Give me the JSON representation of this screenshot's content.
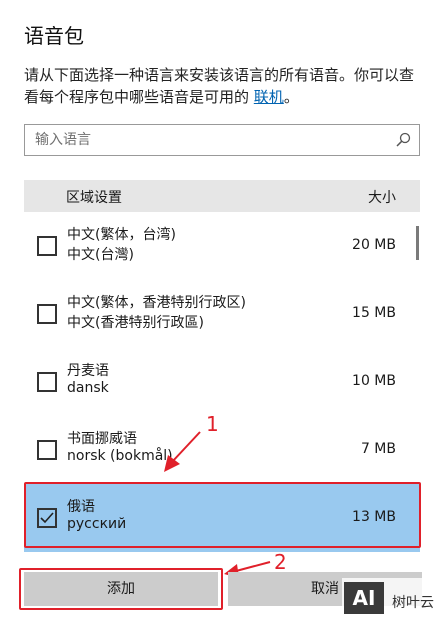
{
  "page": {
    "title": "语音包",
    "description_text": "请从下面选择一种语言来安装该语言的所有语音。你可以查看每个程序包中哪些语音是可用的",
    "description_link": "联机",
    "description_end": "。"
  },
  "search": {
    "placeholder": "输入语言",
    "icon": "search-icon"
  },
  "list": {
    "header": {
      "region": "区域设置",
      "size": "大小"
    },
    "rows": [
      {
        "name": "中文(繁体，台湾)",
        "native": "中文(台灣)",
        "size": "20 MB",
        "checked": false
      },
      {
        "name": "中文(繁体，香港特别行政区)",
        "native": "中文(香港特别行政區)",
        "size": "15 MB",
        "checked": false
      },
      {
        "name": "丹麦语",
        "native": "dansk",
        "size": "10 MB",
        "checked": false
      },
      {
        "name": "书面挪威语",
        "native": "norsk (bokmål)",
        "size": "7 MB",
        "checked": false
      },
      {
        "name": "俄语",
        "native": "русский",
        "size": "13 MB",
        "checked": true
      }
    ]
  },
  "buttons": {
    "add": "添加",
    "cancel": "取消"
  },
  "annotations": {
    "one": "1",
    "two": "2",
    "color": "#e0202a"
  },
  "watermark": {
    "logo": "AI",
    "text": "树叶云"
  },
  "colors": {
    "selected_row": "#99c9ef",
    "link": "#0063b1",
    "button": "#cccccc",
    "header": "#e6e6e6"
  }
}
